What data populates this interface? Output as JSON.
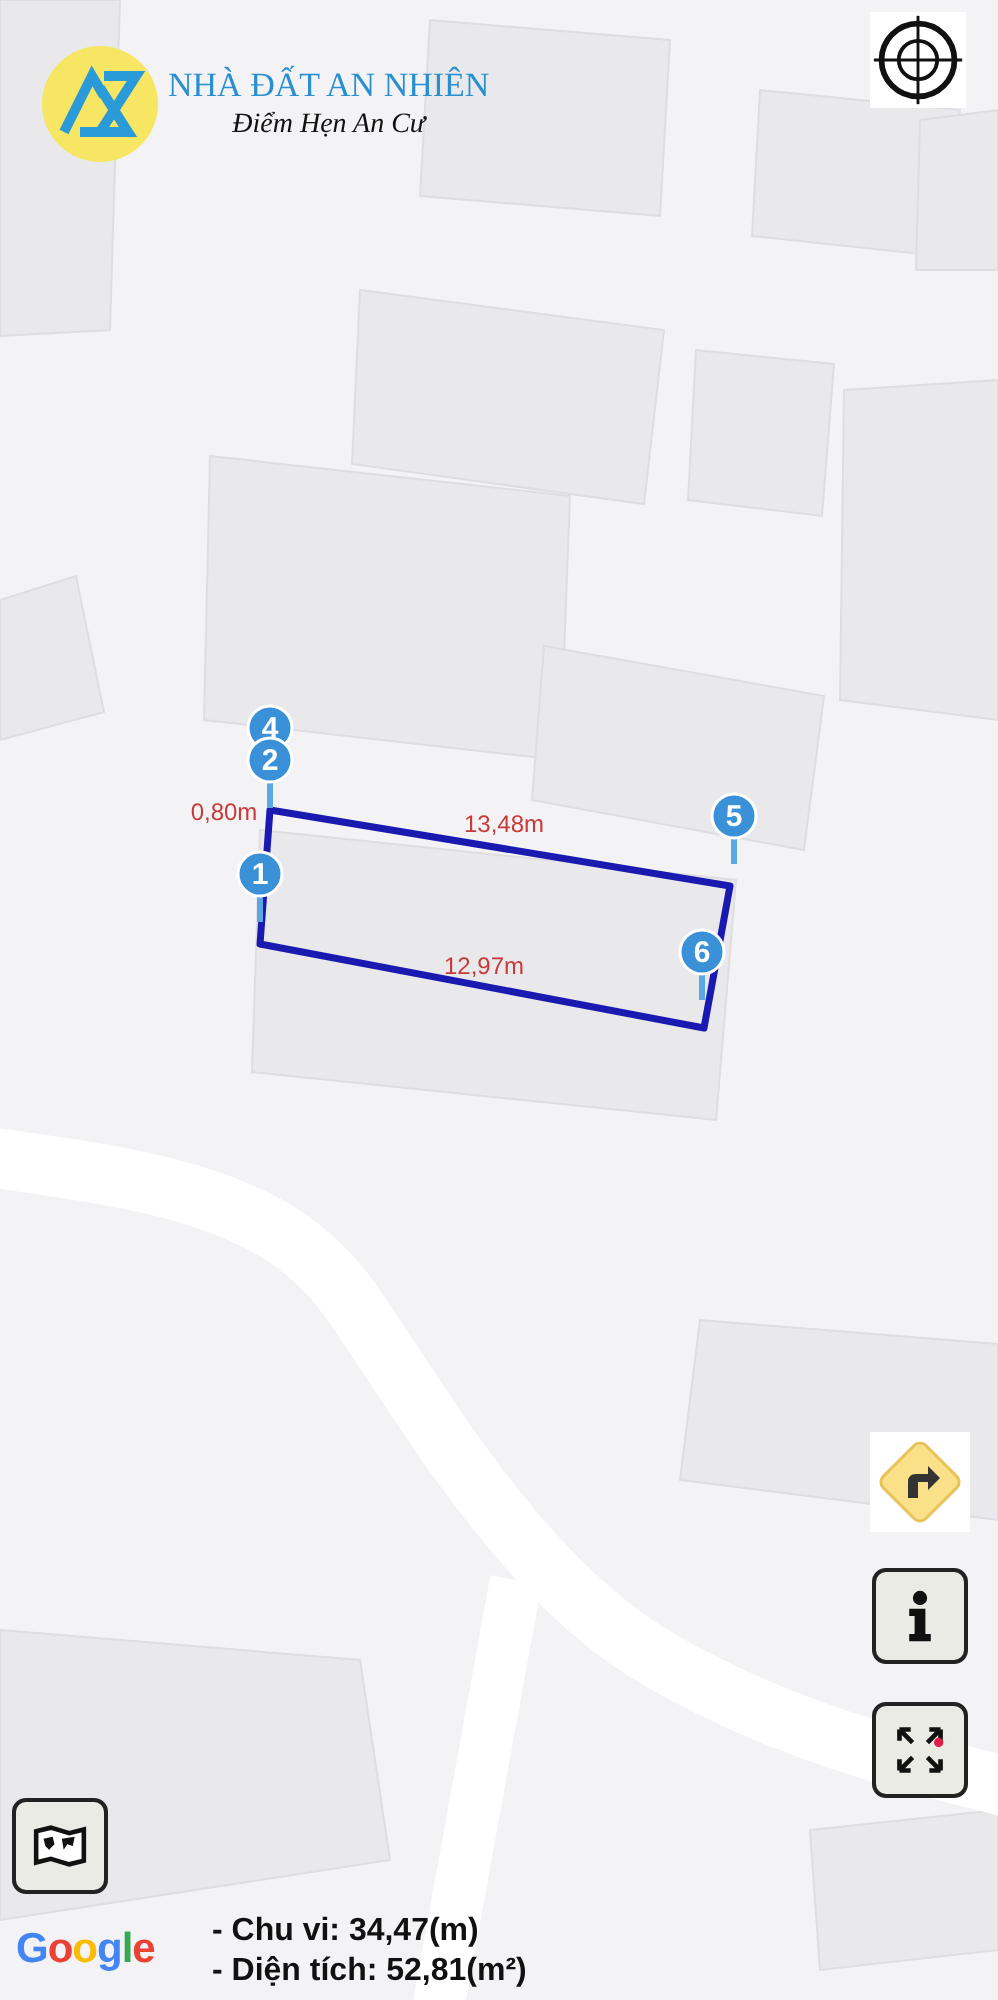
{
  "logo": {
    "title": "NHÀ ĐẤT AN NHIÊN",
    "slogan": "Điểm Hẹn An Cư"
  },
  "plot": {
    "edge_labels": [
      "0,80m",
      "13,48m",
      "12,97m"
    ],
    "markers": [
      "4",
      "2",
      "1",
      "5",
      "6"
    ]
  },
  "attribution": "Google",
  "measurements": [
    "- Chu vi: 34,47(m)",
    "- Diện tích: 52,81(m²)"
  ]
}
